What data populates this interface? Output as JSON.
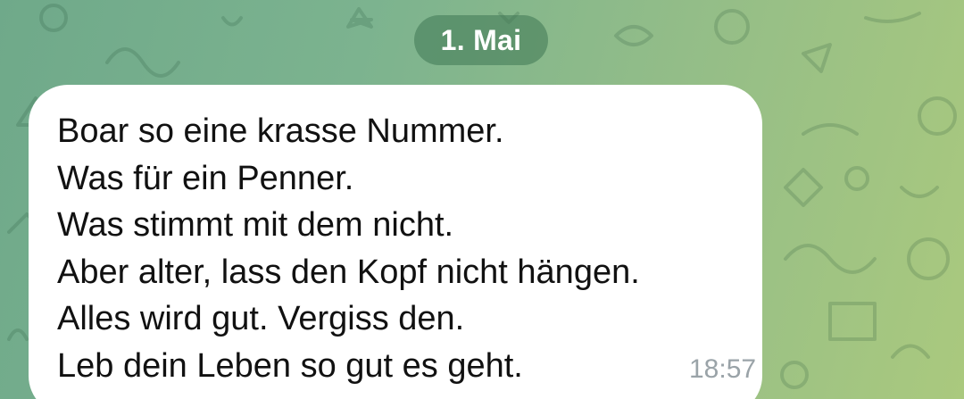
{
  "background": {
    "gradient_start": "#6fa98a",
    "gradient_end": "#aac97e"
  },
  "date_separator": {
    "label": "1. Mai"
  },
  "message": {
    "lines": [
      "Boar so eine krasse Nummer.",
      "Was für ein Penner.",
      "Was stimmt mit dem nicht.",
      "Aber alter, lass den Kopf nicht hängen.",
      "Alles wird gut. Vergiss den.",
      "Leb dein Leben so gut es geht."
    ],
    "time": "18:57"
  }
}
